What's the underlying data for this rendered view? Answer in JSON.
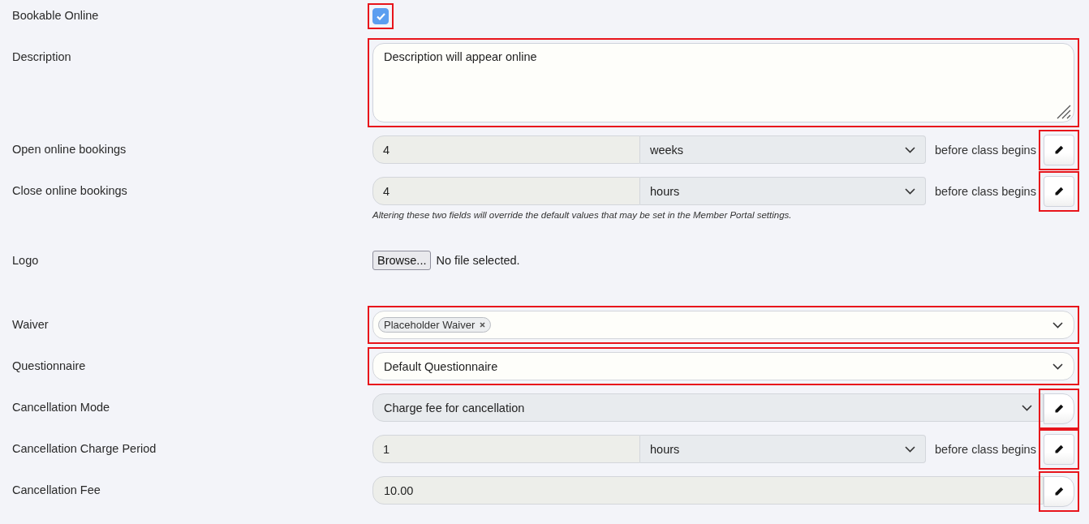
{
  "rows": [
    {
      "kind": "checkbox",
      "label": "Bookable Online",
      "checked": true,
      "highlighted": true
    },
    {
      "kind": "textarea",
      "label": "Description",
      "value": "Description will appear online",
      "highlighted": true
    },
    {
      "kind": "period",
      "label": "Open online bookings",
      "amount": "4",
      "unit": "weeks",
      "suffix": "before class begins",
      "highlighted": true
    },
    {
      "kind": "period",
      "label": "Close online bookings",
      "amount": "4",
      "unit": "hours",
      "suffix": "before class begins",
      "highlighted": true,
      "hint": "Altering these two fields will override the default values that may be set in the Member Portal settings."
    },
    {
      "kind": "file",
      "label": "Logo",
      "button": "Browse...",
      "status": "No file selected."
    },
    {
      "kind": "tags",
      "label": "Waiver",
      "tags": [
        "Placeholder Waiver"
      ],
      "highlighted": true
    },
    {
      "kind": "select",
      "label": "Questionnaire",
      "value": "Default Questionnaire",
      "highlighted": true
    },
    {
      "kind": "select_edit",
      "label": "Cancellation Mode",
      "value": "Charge fee for cancellation",
      "highlighted": true
    },
    {
      "kind": "period",
      "label": "Cancellation Charge Period",
      "amount": "1",
      "unit": "hours",
      "suffix": "before class begins",
      "highlighted": true
    },
    {
      "kind": "text_edit",
      "label": "Cancellation Fee",
      "value": "10.00",
      "highlighted": true
    }
  ]
}
